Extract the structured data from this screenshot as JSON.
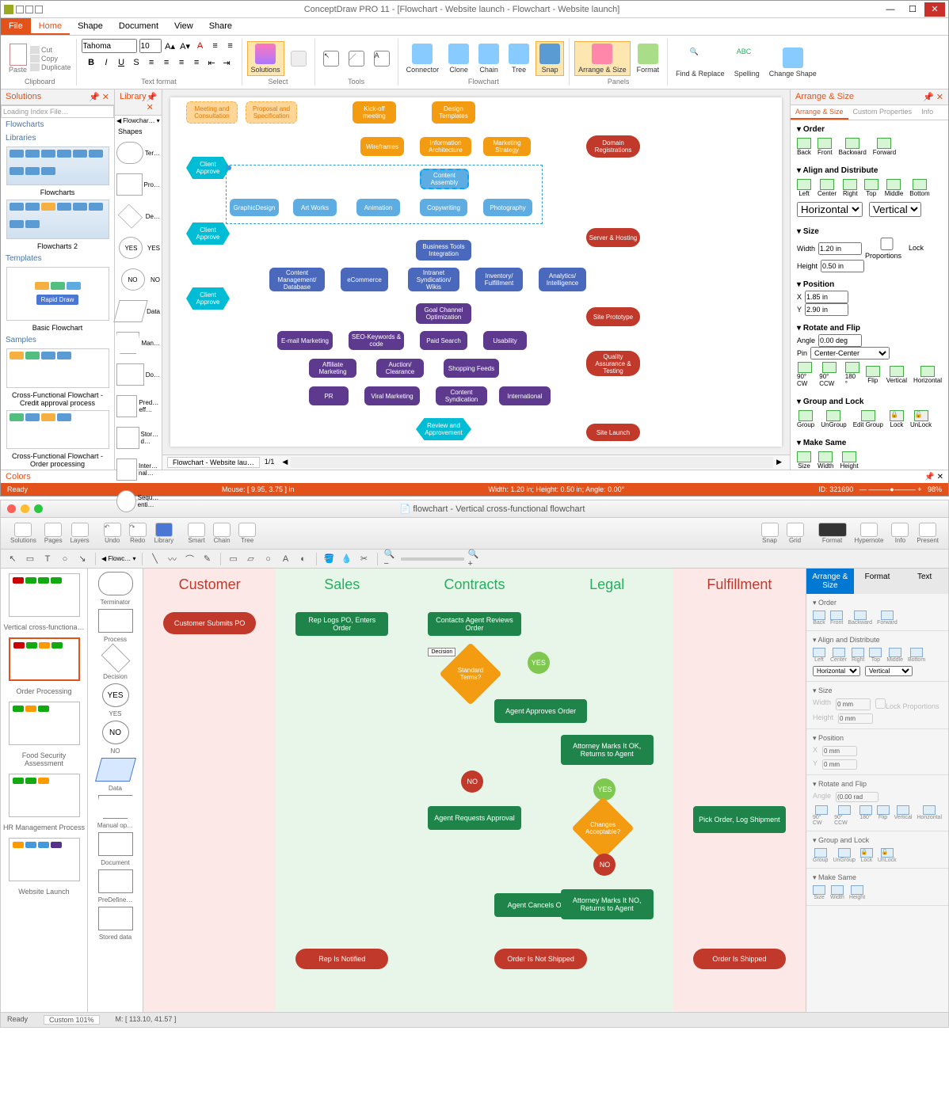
{
  "win": {
    "title": "ConceptDraw PRO 11 - [Flowchart - Website launch - Flowchart - Website launch]",
    "menu": {
      "file": "File",
      "home": "Home",
      "shape": "Shape",
      "document": "Document",
      "view": "View",
      "share": "Share"
    },
    "ribbon": {
      "paste": "Paste",
      "cut": "Cut",
      "copy": "Copy",
      "duplicate": "Duplicate",
      "clipboard": "Clipboard",
      "font_name": "Tahoma",
      "font_size": "10",
      "text_format": "Text format",
      "solutions": "Solutions",
      "select": "Select",
      "tools": "Tools",
      "connector": "Connector",
      "clone": "Clone",
      "chain": "Chain",
      "tree": "Tree",
      "snap": "Snap",
      "flowchart": "Flowchart",
      "arrange_size": "Arrange & Size",
      "format": "Format",
      "panels": "Panels",
      "find_replace": "Find & Replace",
      "spelling": "Spelling",
      "change_shape": "Change Shape"
    },
    "solutions_panel": {
      "title": "Solutions",
      "search_ph": "Loading Index File…",
      "flowcharts": "Flowcharts",
      "libraries": "Libraries",
      "lib_flowcharts": "Flowcharts",
      "lib_flowcharts2": "Flowcharts 2",
      "templates": "Templates",
      "rapid_draw": "Rapid Draw",
      "basic_flowchart": "Basic Flowchart",
      "samples": "Samples",
      "sample1": "Cross-Functional Flowchart - Credit approval process",
      "sample2": "Cross-Functional Flowchart - Order processing"
    },
    "library_panel": {
      "title": "Library",
      "crumb": "Flowchar…",
      "shapes": "Shapes",
      "items": [
        "Ter…",
        "Pro…",
        "De…",
        "YES",
        "NO",
        "Data",
        "Man…",
        "Do…",
        "Pred…eff…",
        "Stor…d…",
        "Inter…nal…",
        "Sequ…enti…"
      ]
    },
    "flowchart": {
      "meeting_consult": "Meeting and Consultation",
      "proposal_spec": "Proposal and Specification",
      "kickoff": "Kick-off meeting",
      "design_templates": "Design Templates",
      "wireframes": "Wireframes",
      "info_arch": "Information Architecture",
      "marketing_strategy": "Marketing Strategy",
      "client_approve": "Client Approve",
      "content_assembly": "Content Assembly",
      "graphic_design": "GraphicDesign",
      "art_works": "Art Works",
      "animation": "Animation",
      "copywriting": "Copywriting",
      "photography": "Photography",
      "biz_tools": "Business Tools Integration",
      "content_mgmt": "Content Management/ Database",
      "ecommerce": "eCommerce",
      "intranet": "Intranet Syndication/ Wikis",
      "inventory": "Inventory/ Fulfillment",
      "analytics": "Analytics/ Intelligence",
      "goal_channel": "Goal Channel Optimization",
      "email_mkt": "E-mail Marketing",
      "seo": "SEO-Keywords & code",
      "paid_search": "Paid Search",
      "usability": "Usability",
      "affiliate": "Affiliate Marketing",
      "auction": "Auction/ Clearance",
      "shopping_feeds": "Shopping Feeds",
      "pr": "PR",
      "viral": "Viral Marketing",
      "content_synd": "Content Syndication",
      "international": "International",
      "review_approve": "Review and Approvement",
      "domain_reg": "Domain Registrations",
      "server_hosting": "Server & Hosting",
      "site_prototype": "Site Prototype",
      "qa_testing": "Quality Assurance & Testing",
      "site_launch": "Site Launch"
    },
    "canvas_tab": "Flowchart - Website lau…",
    "canvas_page": "1/1",
    "arrange_panel": {
      "title": "Arrange & Size",
      "tab_arrange": "Arrange & Size",
      "tab_custom": "Custom Properties",
      "tab_info": "Info",
      "order": "Order",
      "back": "Back",
      "front": "Front",
      "backward": "Backward",
      "forward": "Forward",
      "align_dist": "Align and Distribute",
      "left": "Left",
      "center": "Center",
      "right": "Right",
      "top": "Top",
      "middle": "Middle",
      "bottom": "Bottom",
      "horizontal": "Horizontal",
      "vertical": "Vertical",
      "size": "Size",
      "width": "Width",
      "width_v": "1.20 in",
      "height": "Height",
      "height_v": "0.50 in",
      "lock_prop": "Lock Proportions",
      "position": "Position",
      "x": "X",
      "x_v": "1.85 in",
      "y": "Y",
      "y_v": "2.90 in",
      "rotate_flip": "Rotate and Flip",
      "angle": "Angle",
      "angle_v": "0.00 deg",
      "pin": "Pin",
      "pin_v": "Center-Center",
      "r90cw": "90° CW",
      "r90ccw": "90° CCW",
      "r180": "180 °",
      "flip": "Flip",
      "group_lock": "Group and Lock",
      "group": "Group",
      "ungroup": "UnGroup",
      "edit_group": "Edit Group",
      "lock": "Lock",
      "unlock": "UnLock",
      "make_same": "Make Same",
      "ms_size": "Size",
      "ms_width": "Width",
      "ms_height": "Height"
    },
    "colors_label": "Colors",
    "status": {
      "ready": "Ready",
      "mouse": "Mouse: [ 9.95, 3.75 ] in",
      "dims": "Width: 1.20 in;  Height: 0.50 in;  Angle: 0.00°",
      "id": "ID: 321690",
      "zoom": "98%"
    }
  },
  "mac": {
    "title": "flowchart - Vertical cross-functional flowchart",
    "toolbar": {
      "solutions": "Solutions",
      "pages": "Pages",
      "layers": "Layers",
      "undo": "Undo",
      "redo": "Redo",
      "library": "Library",
      "smart": "Smart",
      "chain": "Chain",
      "tree": "Tree",
      "snap": "Snap",
      "grid": "Grid",
      "format": "Format",
      "hypernote": "Hypernote",
      "info": "Info",
      "present": "Present"
    },
    "left_panel": {
      "t1": "Vertical cross-functiona…",
      "t2": "Order Processing",
      "t3": "Food Security Assessment",
      "t4": "HR Management Process",
      "t5": "Website Launch"
    },
    "library": {
      "crumb": "Flowc…",
      "terminator": "Terminator",
      "process": "Process",
      "decision": "Decision",
      "yes": "YES",
      "no": "NO",
      "data": "Data",
      "manual_op": "Manual op…",
      "document": "Document",
      "predefined": "PreDefine…",
      "stored": "Stored data"
    },
    "lanes": {
      "customer": "Customer",
      "sales": "Sales",
      "contracts": "Contracts",
      "legal": "Legal",
      "fulfillment": "Fulfillment"
    },
    "flow": {
      "submits_po": "Customer Submits PO",
      "rep_logs": "Rep Logs PO, Enters Order",
      "contacts_agent": "Contacts Agent Reviews Order",
      "decision_lbl": "Decision",
      "standard_terms": "Standard Terms?",
      "yes": "YES",
      "no": "NO",
      "agent_approves": "Agent Approves Order",
      "attorney_ok": "Attorney Marks It OK, Returns to Agent",
      "changes_acc": "Changes Acceptable?",
      "agent_requests": "Agent Requests Approval",
      "pick_order": "Pick Order, Log Shipment",
      "agent_cancels": "Agent Cancels Order",
      "attorney_no": "Attorney Marks It NO, Returns to Agent",
      "rep_notified": "Rep Is Notified",
      "not_shipped": "Order Is Not Shipped",
      "shipped": "Order Is Shipped"
    },
    "arrange": {
      "tab_arrange": "Arrange & Size",
      "tab_format": "Format",
      "tab_text": "Text",
      "order": "Order",
      "back": "Back",
      "front": "Front",
      "backward": "Backward",
      "forward": "Forward",
      "align_dist": "Align and Distribute",
      "left": "Left",
      "center": "Center",
      "right": "Right",
      "top": "Top",
      "middle": "Middle",
      "bottom": "Bottom",
      "horizontal": "Horizontal",
      "vertical": "Vertical",
      "size": "Size",
      "width": "Width",
      "width_v": "0 mm",
      "height": "Height",
      "height_v": "0 mm",
      "lock_prop": "Lock Proportions",
      "position": "Position",
      "x": "X",
      "x_v": "0 mm",
      "y": "Y",
      "y_v": "0 mm",
      "rotate_flip": "Rotate and Flip",
      "angle": "Angle",
      "angle_v": "(0.00 rad",
      "r90cw": "90° CW",
      "r90ccw": "90° CCW",
      "r180": "180°",
      "flip": "Flip",
      "group_lock": "Group and Lock",
      "group": "Group",
      "ungroup": "UnGroup",
      "lock": "Lock",
      "unlock": "UnLock",
      "make_same": "Make Same",
      "ms_size": "Size",
      "ms_width": "Width",
      "ms_height": "Height"
    },
    "status": {
      "ready": "Ready",
      "zoom": "Custom 101%",
      "mouse": "M: [ 113.10, 41.57 ]"
    }
  },
  "color_swatches": [
    "#000",
    "#3d3d3d",
    "#666",
    "#888",
    "#aaa",
    "#ccc",
    "#eee",
    "#fff",
    "#400",
    "#600",
    "#800",
    "#a00",
    "#c00",
    "#e44",
    "#f88",
    "#fcc",
    "#430",
    "#640",
    "#860",
    "#a80",
    "#ca0",
    "#ec4",
    "#fe8",
    "#ffc",
    "#040",
    "#060",
    "#080",
    "#0a0",
    "#4c4",
    "#8e8",
    "#afa",
    "#dfd",
    "#044",
    "#066",
    "#088",
    "#0aa",
    "#4cc",
    "#8ee",
    "#aff",
    "#dff",
    "#004",
    "#006",
    "#008",
    "#22a",
    "#44c",
    "#88e",
    "#aaf",
    "#ddf",
    "#404",
    "#606",
    "#808",
    "#a2a",
    "#c4c",
    "#e8e",
    "#faf",
    "#fdf"
  ]
}
